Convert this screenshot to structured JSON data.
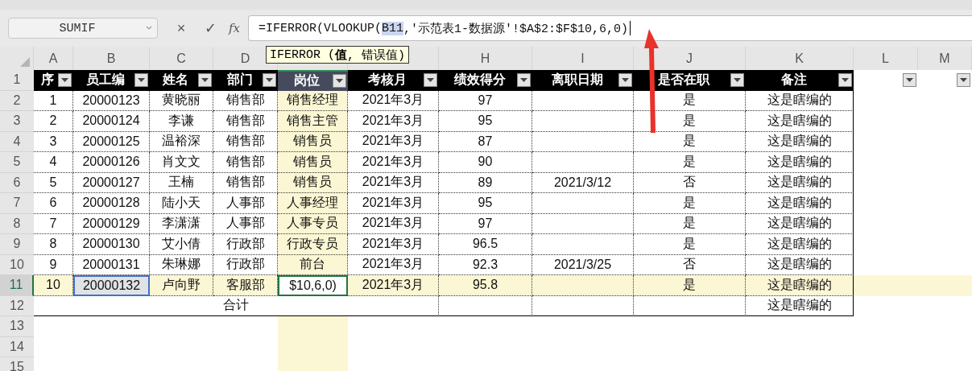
{
  "name_box": "SUMIF",
  "formula_bar": {
    "cancel": "×",
    "enter": "✓",
    "fx": "fx",
    "before_ref": "=IFERROR(VLOOKUP(",
    "ref": "B11",
    "after_ref": ",'示范表1-数据源'!$A$2:$F$10,6,0)"
  },
  "tooltip": "IFERROR (**值**, 错误值)",
  "column_letters": [
    {
      "kind": "letter",
      "letter": "A"
    },
    {
      "kind": "letter",
      "letter": "B"
    },
    {
      "kind": "letter",
      "letter": "C"
    },
    {
      "kind": "letter",
      "letter": "D"
    },
    {
      "kind": "covered"
    },
    {
      "kind": "covered"
    },
    {
      "kind": "letter",
      "letter": "H"
    },
    {
      "kind": "letter",
      "letter": "I"
    },
    {
      "kind": "letter",
      "letter": "J"
    },
    {
      "kind": "letter",
      "letter": "K"
    },
    {
      "kind": "letter",
      "letter": "L"
    },
    {
      "kind": "letter",
      "letter": "M"
    }
  ],
  "header_row_number": "1",
  "headers": [
    {
      "label": "序",
      "filter": true,
      "selected": false
    },
    {
      "label": "员工编",
      "filter": true,
      "selected": false
    },
    {
      "label": "姓名",
      "filter": true,
      "selected": false
    },
    {
      "label": "部门",
      "filter": true,
      "selected": false
    },
    {
      "label": "岗位",
      "filter": true,
      "selected": true
    },
    {
      "label": "考核月",
      "filter": true,
      "selected": false
    },
    {
      "label": "绩效得分",
      "filter": true,
      "selected": false
    },
    {
      "label": "离职日期",
      "filter": true,
      "selected": false
    },
    {
      "label": "是否在职",
      "filter": true,
      "selected": false
    },
    {
      "label": "备注",
      "filter": true,
      "selected": false
    },
    {
      "filter": true,
      "selected": false
    },
    {
      "filter": true,
      "selected": false
    }
  ],
  "rows": [
    {
      "kind": "data",
      "number": "2",
      "selected": false,
      "cells": [
        "1",
        "20000123",
        "黄晓丽",
        "销售部",
        "销售经理",
        "2021年3月",
        "97",
        null,
        "是",
        "这是瞎编的"
      ]
    },
    {
      "kind": "data",
      "number": "3",
      "selected": false,
      "cells": [
        "2",
        "20000124",
        "李谦",
        "销售部",
        "销售主管",
        "2021年3月",
        "95",
        null,
        "是",
        "这是瞎编的"
      ]
    },
    {
      "kind": "data",
      "number": "4",
      "selected": false,
      "cells": [
        "3",
        "20000125",
        "温裕深",
        "销售部",
        "销售员",
        "2021年3月",
        "87",
        null,
        "是",
        "这是瞎编的"
      ]
    },
    {
      "kind": "data",
      "number": "5",
      "selected": false,
      "cells": [
        "4",
        "20000126",
        "肖文文",
        "销售部",
        "销售员",
        "2021年3月",
        "90",
        null,
        "是",
        "这是瞎编的"
      ]
    },
    {
      "kind": "data",
      "number": "6",
      "selected": false,
      "cells": [
        "5",
        "20000127",
        "王楠",
        "销售部",
        "销售员",
        "2021年3月",
        "89",
        "2021/3/12",
        "否",
        "这是瞎编的"
      ]
    },
    {
      "kind": "data",
      "number": "7",
      "selected": false,
      "cells": [
        "6",
        "20000128",
        "陆小天",
        "人事部",
        "人事经理",
        "2021年3月",
        "95",
        null,
        "是",
        "这是瞎编的"
      ]
    },
    {
      "kind": "data",
      "number": "8",
      "selected": false,
      "cells": [
        "7",
        "20000129",
        "李潇潇",
        "人事部",
        "人事专员",
        "2021年3月",
        "97",
        null,
        "是",
        "这是瞎编的"
      ]
    },
    {
      "kind": "data",
      "number": "9",
      "selected": false,
      "cells": [
        "8",
        "20000130",
        "艾小倩",
        "行政部",
        "行政专员",
        "2021年3月",
        "96.5",
        null,
        "是",
        "这是瞎编的"
      ]
    },
    {
      "kind": "data",
      "number": "10",
      "selected": false,
      "cells": [
        "9",
        "20000131",
        "朱琳娜",
        "行政部",
        "前台",
        "2021年3月",
        "92.3",
        "2021/3/25",
        "否",
        "这是瞎编的"
      ]
    },
    {
      "kind": "data",
      "number": "11",
      "selected": true,
      "cells": [
        "10",
        {
          "text": "20000132",
          "referenced": true
        },
        "卢向野",
        "客服部",
        "$10,6,0)",
        "2021年3月",
        "95.8",
        null,
        "是",
        "这是瞎编的"
      ]
    },
    {
      "kind": "total",
      "number": "12",
      "selected": false,
      "label": "合计",
      "note": "这是瞎编的"
    },
    {
      "kind": "empty",
      "number": "13",
      "selected": false
    },
    {
      "kind": "empty",
      "number": "14",
      "selected": false
    },
    {
      "kind": "empty",
      "number": "15",
      "selected": false
    }
  ]
}
